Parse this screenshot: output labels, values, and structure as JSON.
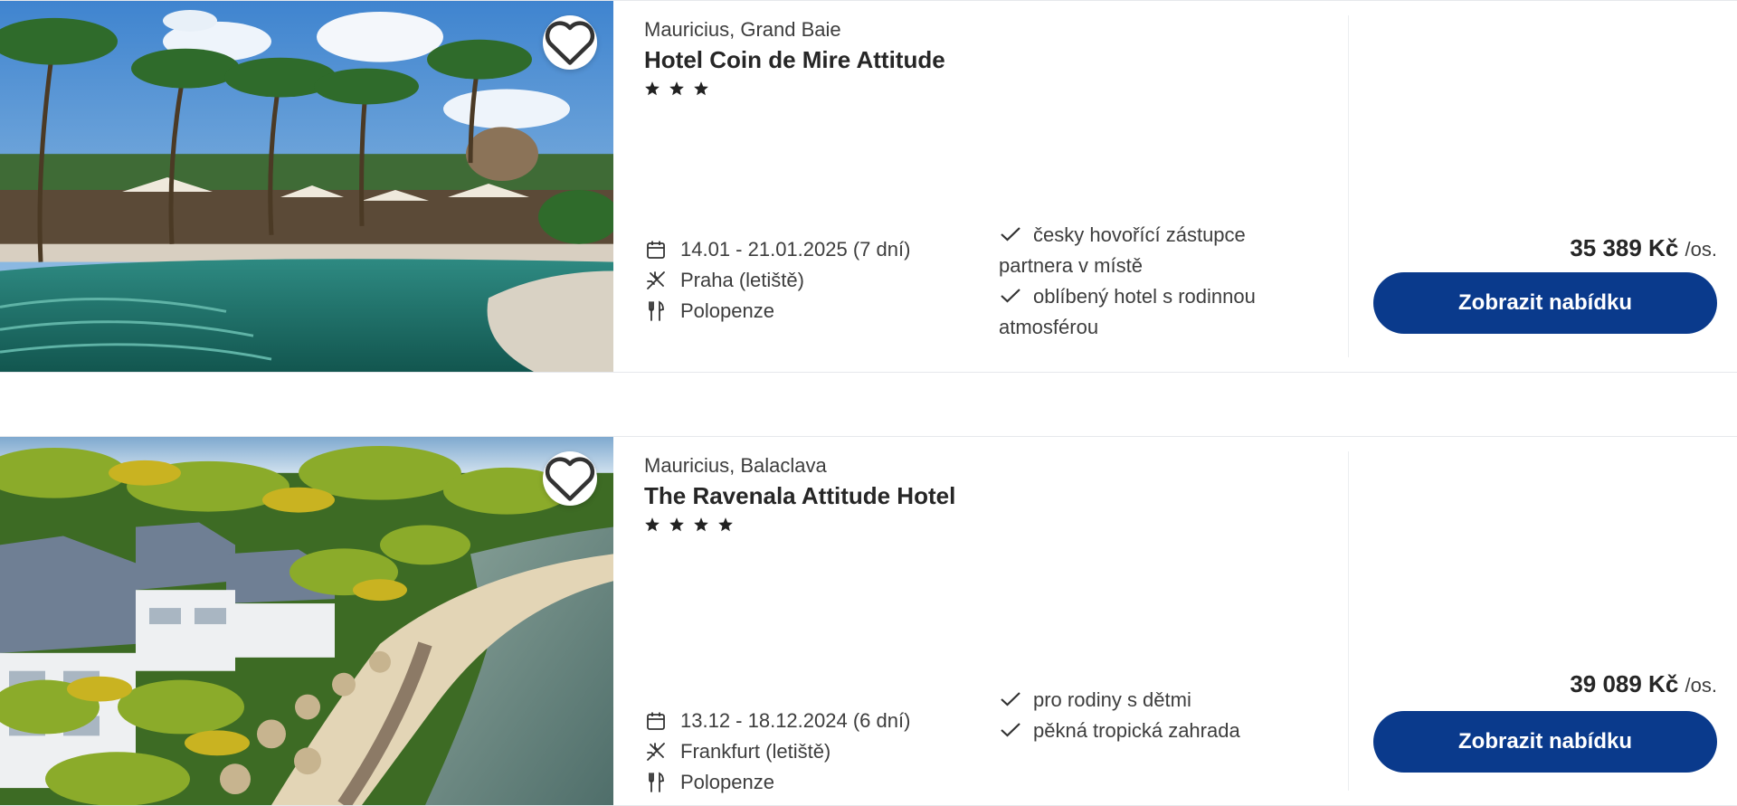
{
  "listings": [
    {
      "location": "Mauricius, Grand Baie",
      "name": "Hotel Coin de Mire Attitude",
      "stars": 3,
      "dates": "14.01 - 21.01.2025 (7 dní)",
      "departure": "Praha (letiště)",
      "board": "Polopenze",
      "features": [
        "česky hovořící zástupce partnera v místě",
        "oblíbený hotel s rodinnou atmosférou"
      ],
      "price": "35 389 Kč",
      "price_unit": "/os.",
      "button_label": "Zobrazit nabídku"
    },
    {
      "location": "Mauricius, Balaclava",
      "name": "The Ravenala Attitude Hotel",
      "stars": 4,
      "dates": "13.12 - 18.12.2024 (6 dní)",
      "departure": "Frankfurt (letiště)",
      "board": "Polopenze",
      "features": [
        "pro rodiny s dětmi",
        "pěkná tropická zahrada"
      ],
      "price": "39 089 Kč",
      "price_unit": "/os.",
      "button_label": "Zobrazit nabídku"
    }
  ],
  "icons": {
    "favorite": "heart-icon",
    "dates": "calendar-icon",
    "departure": "plane-icon",
    "board": "fork-knife-icon",
    "feature": "check-icon",
    "rating": "star-icon"
  },
  "colors": {
    "button": "#0a3a8c",
    "text": "#2b2b2b",
    "border": "#e6e8ec"
  }
}
